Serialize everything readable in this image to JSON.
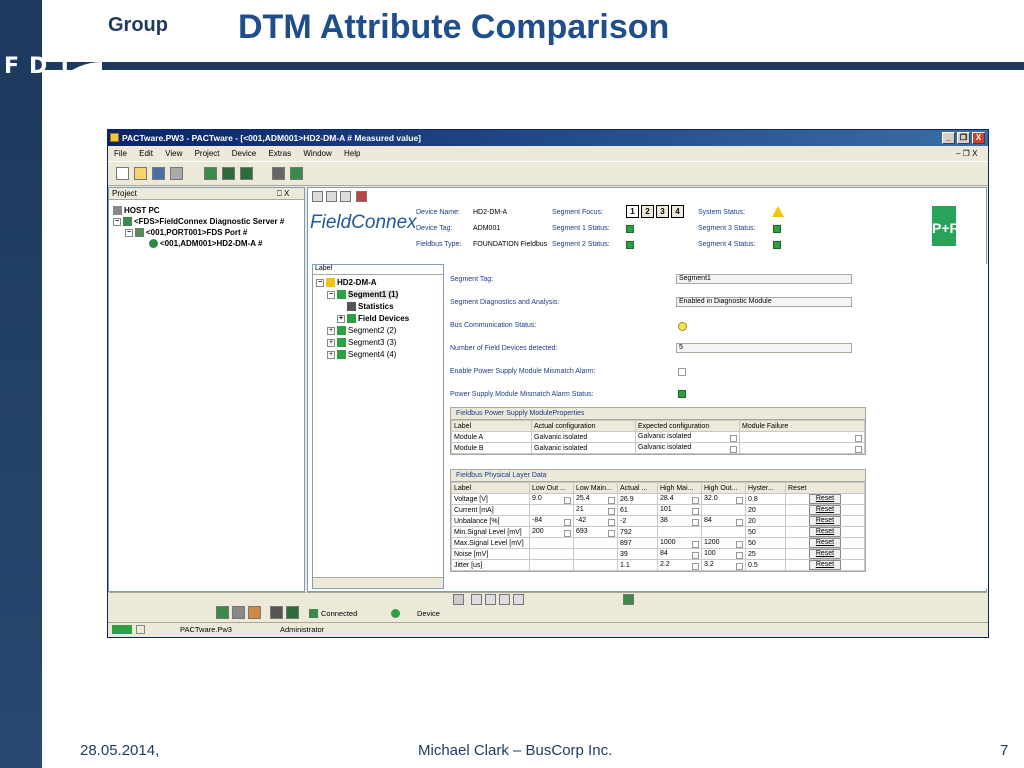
{
  "slide": {
    "brand_group": "Group",
    "brand_fdt": "FDT",
    "title": "DTM Attribute Comparison",
    "footer_date": "28.05.2014,",
    "footer_author": "Michael Clark – BusCorp Inc.",
    "footer_page": "7"
  },
  "window": {
    "title": "PACTware.PW3 - PACTware - [<001,ADM001>HD2-DM-A # Measured value]",
    "controls": [
      "_",
      "❐",
      "X"
    ],
    "menu": [
      "File",
      "Edit",
      "View",
      "Project",
      "Device",
      "Extras",
      "Window",
      "Help"
    ],
    "menu_right": "– ❐ X"
  },
  "project": {
    "header": "Project",
    "header_controls": "⎕ X",
    "tree": [
      "HOST PC",
      "<FDS>FieldConnex Diagnostic Server #",
      "<001,PORT001>FDS Port #",
      "<001,ADM001>HD2-DM-A #"
    ]
  },
  "dtm": {
    "logo": "FieldConnex",
    "device_name_label": "Device Name:",
    "device_name": "HD2-DM-A",
    "device_tag_label": "Device Tag:",
    "device_tag": "ADM001",
    "fieldbus_type_label": "Fieldbus Type:",
    "fieldbus_type": "FOUNDATION Fieldbus",
    "segment_focus_label": "Segment Focus:",
    "segment_buttons": [
      "1",
      "2",
      "3",
      "4"
    ],
    "seg1_status_label": "Segment 1 Status:",
    "seg2_status_label": "Segment 2 Status:",
    "system_status_label": "System Status:",
    "seg3_status_label": "Segment 3 Status:",
    "seg4_status_label": "Segment 4 Status:",
    "pf_logo": "P+F"
  },
  "label_tree": {
    "header": "Label",
    "items": [
      "HD2-DM-A",
      "Segment1 (1)",
      "Statistics",
      "Field Devices",
      "Segment2 (2)",
      "Segment3 (3)",
      "Segment4 (4)"
    ]
  },
  "detail": {
    "segment_tag_label": "Segment Tag:",
    "segment_tag_value": "Segment1",
    "diag_label": "Segment Diagnostics and Analysis:",
    "diag_value": "Enabled in Diagnostic Module",
    "bus_comm_label": "Bus Communication Status:",
    "num_devices_label": "Number of Field Devices detected:",
    "num_devices_value": "5",
    "enable_psm_label": "Enable Power Supply Module Mismatch Alarm:",
    "psm_status_label": "Power Supply Module Mismatch Alarm Status:"
  },
  "psm_table": {
    "title": "Fieldbus Power Supply ModuleProperties",
    "headers": [
      "Label",
      "Actual configuration",
      "Expected configuration",
      "Module Failure"
    ],
    "rows": [
      [
        "Module A",
        "Galvanic isolated",
        "Galvanic isolated",
        ""
      ],
      [
        "Module B",
        "Galvanic isolated",
        "Galvanic isolated",
        ""
      ]
    ]
  },
  "phys_table": {
    "title": "Fieldbus Physical Layer Data",
    "headers": [
      "Label",
      "Low Out ...",
      "Low Main...",
      "Actual ...",
      "High Mai...",
      "High Out...",
      "Hyster...",
      "Reset"
    ],
    "rows": [
      [
        "Voltage [V]",
        "9.0",
        "25.4",
        "26.9",
        "28.4",
        "32.0",
        "0.8",
        "Reset"
      ],
      [
        "Current [mA]",
        "",
        "21",
        "61",
        "101",
        "",
        "20",
        "Reset"
      ],
      [
        "Unbalance [%]",
        "-84",
        "-42",
        "-2",
        "38",
        "84",
        "20",
        "Reset"
      ],
      [
        "Min.Signal Level [mV]",
        "200",
        "693",
        "792",
        "",
        "",
        "50",
        "Reset"
      ],
      [
        "Max.Signal Level [mV]",
        "",
        "",
        "897",
        "1000",
        "1200",
        "50",
        "Reset"
      ],
      [
        "Noise [mV]",
        "",
        "",
        "39",
        "84",
        "100",
        "25",
        "Reset"
      ],
      [
        "Jitter [us]",
        "",
        "",
        "1.1",
        "2.2",
        "3.2",
        "0.5",
        "Reset"
      ]
    ]
  },
  "status": {
    "connected": "Connected",
    "device": "Device",
    "taskbar_file": "PACTware.Pw3",
    "taskbar_user": "Administrator"
  },
  "colors": {
    "navy": "#1e3a5f",
    "title_blue": "#1e4f8c",
    "ok_green": "#2ea043"
  }
}
